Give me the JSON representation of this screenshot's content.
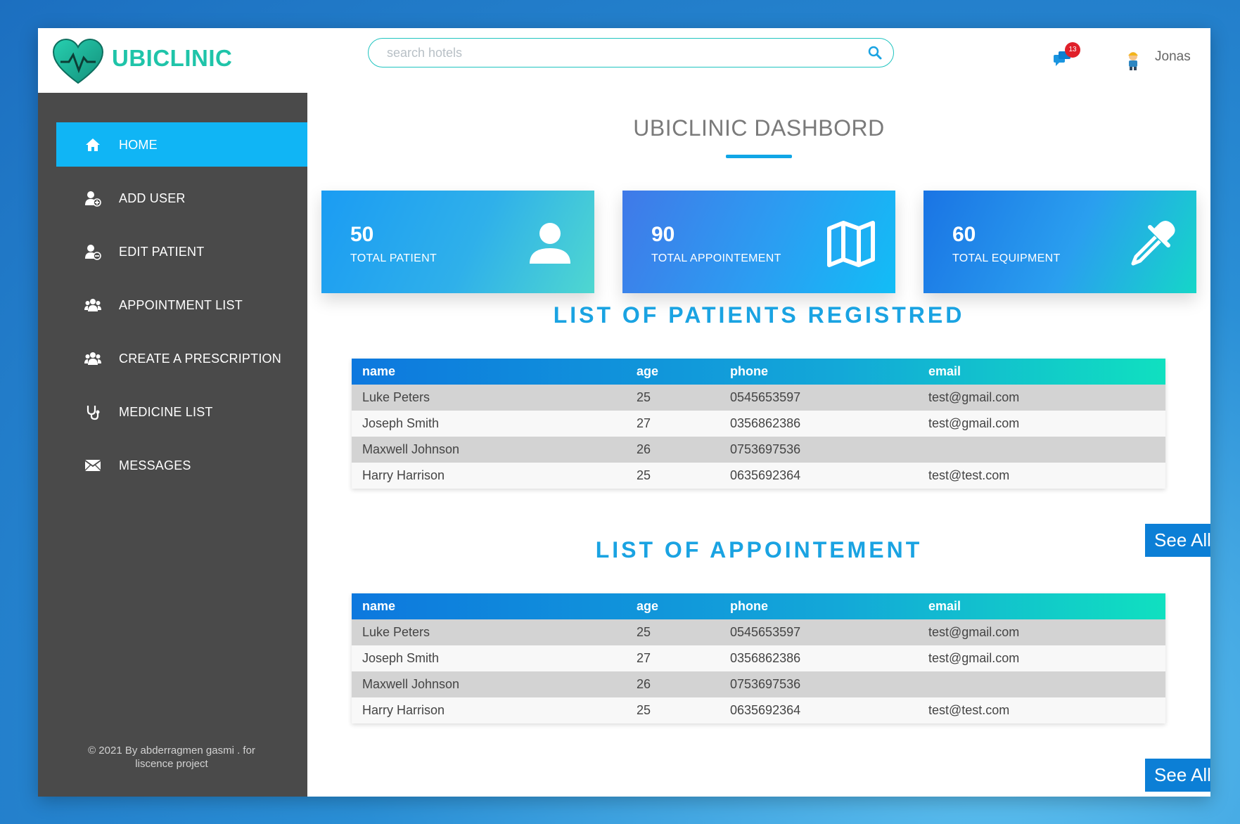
{
  "brand": {
    "name": "UBICLINIC",
    "color": "#1fc4a9"
  },
  "search": {
    "placeholder": "search hotels",
    "value": ""
  },
  "header": {
    "notification_count": "13",
    "user_name": "Jonas"
  },
  "sidebar": {
    "items": [
      {
        "label": "HOME",
        "icon": "home-icon",
        "active": true
      },
      {
        "label": "ADD USER",
        "icon": "user-plus-icon"
      },
      {
        "label": "EDIT PATIENT",
        "icon": "user-minus-icon"
      },
      {
        "label": "APPOINTMENT LIST",
        "icon": "users-icon"
      },
      {
        "label": "CREATE A PRESCRIPTION",
        "icon": "users-icon"
      },
      {
        "label": "MEDICINE LIST",
        "icon": "stethoscope-icon"
      },
      {
        "label": "MESSAGES",
        "icon": "envelope-icon"
      }
    ],
    "footer_line1": "© 2021 By abderragmen gasmi . for",
    "footer_line2": "liscence project"
  },
  "main": {
    "title": "UBICLINIC DASHBORD",
    "stats": [
      {
        "value": "50",
        "label": "TOTAL PATIENT",
        "icon": "user-icon"
      },
      {
        "value": "90",
        "label": "TOTAL APPOINTEMENT",
        "icon": "map-icon"
      },
      {
        "value": "60",
        "label": "TOTAL EQUIPMENT",
        "icon": "eyedropper-icon"
      }
    ],
    "patients": {
      "title": "LIST OF PATIENTS REGISTRED",
      "columns": [
        "name",
        "age",
        "phone",
        "email"
      ],
      "rows": [
        [
          "Luke Peters",
          "25",
          "0545653597",
          "test@gmail.com"
        ],
        [
          "Joseph Smith",
          "27",
          "0356862386",
          "test@gmail.com"
        ],
        [
          "Maxwell Johnson",
          "26",
          "0753697536",
          ""
        ],
        [
          "Harry Harrison",
          "25",
          "0635692364",
          "test@test.com"
        ]
      ],
      "see_all": "See All"
    },
    "appointments": {
      "title": "LIST OF APPOINTEMENT",
      "columns": [
        "name",
        "age",
        "phone",
        "email"
      ],
      "rows": [
        [
          "Luke Peters",
          "25",
          "0545653597",
          "test@gmail.com"
        ],
        [
          "Joseph Smith",
          "27",
          "0356862386",
          "test@gmail.com"
        ],
        [
          "Maxwell Johnson",
          "26",
          "0753697536",
          ""
        ],
        [
          "Harry Harrison",
          "25",
          "0635692364",
          "test@test.com"
        ]
      ],
      "see_all": "See All"
    }
  },
  "colors": {
    "sidebar_bg": "#4a4a4a",
    "active_item": "#10b5f5",
    "accent": "#1aa3e2",
    "button": "#0c7fd6"
  }
}
